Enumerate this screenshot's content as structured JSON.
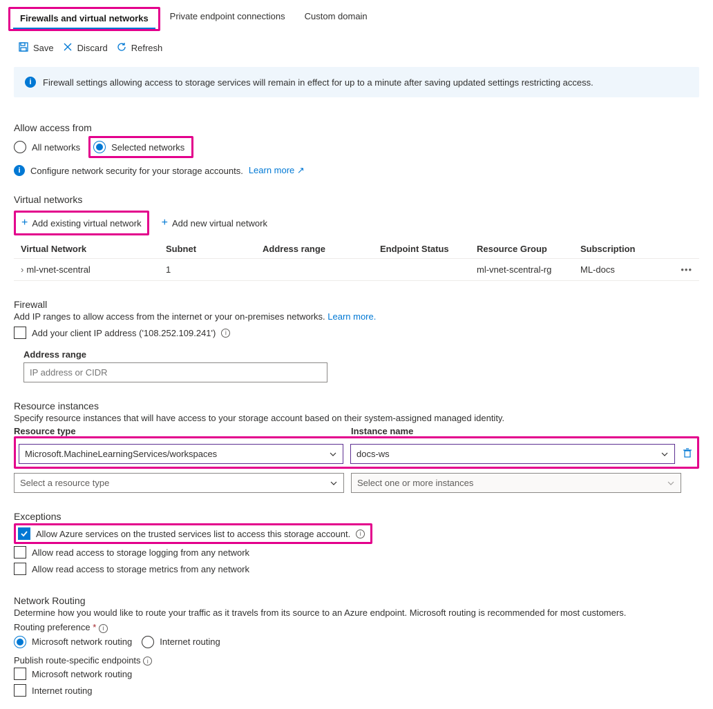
{
  "tabs": {
    "t0": "Firewalls and virtual networks",
    "t1": "Private endpoint connections",
    "t2": "Custom domain"
  },
  "toolbar": {
    "save": "Save",
    "discard": "Discard",
    "refresh": "Refresh"
  },
  "banner": "Firewall settings allowing access to storage services will remain in effect for up to a minute after saving updated settings restricting access.",
  "access": {
    "title": "Allow access from",
    "all": "All networks",
    "selected": "Selected networks",
    "note": "Configure network security for your storage accounts.",
    "learn": "Learn more"
  },
  "vnet": {
    "title": "Virtual networks",
    "add_existing": "Add existing virtual network",
    "add_new": "Add new virtual network",
    "headers": {
      "h0": "Virtual Network",
      "h1": "Subnet",
      "h2": "Address range",
      "h3": "Endpoint Status",
      "h4": "Resource Group",
      "h5": "Subscription"
    },
    "rows": [
      {
        "name": "ml-vnet-scentral",
        "subnet": "1",
        "addr": "",
        "ep": "",
        "rg": "ml-vnet-scentral-rg",
        "sub": "ML-docs"
      }
    ]
  },
  "firewall": {
    "title": "Firewall",
    "sub": "Add IP ranges to allow access from the internet or your on-premises networks.",
    "learn": "Learn more.",
    "add_client": "Add your client IP address ('108.252.109.241')",
    "addr_label": "Address range",
    "addr_placeholder": "IP address or CIDR"
  },
  "ri": {
    "title": "Resource instances",
    "sub": "Specify resource instances that will have access to your storage account based on their system-assigned managed identity.",
    "h_type": "Resource type",
    "h_name": "Instance name",
    "rows": [
      {
        "type": "Microsoft.MachineLearningServices/workspaces",
        "name": "docs-ws"
      }
    ],
    "placeholder_type": "Select a resource type",
    "placeholder_name": "Select one or more instances"
  },
  "exceptions": {
    "title": "Exceptions",
    "e0": "Allow Azure services on the trusted services list to access this storage account.",
    "e1": "Allow read access to storage logging from any network",
    "e2": "Allow read access to storage metrics from any network"
  },
  "routing": {
    "title": "Network Routing",
    "sub": "Determine how you would like to route your traffic as it travels from its source to an Azure endpoint. Microsoft routing is recommended for most customers.",
    "pref_label": "Routing preference",
    "ms": "Microsoft network routing",
    "inet": "Internet routing",
    "pub_label": "Publish route-specific endpoints"
  }
}
